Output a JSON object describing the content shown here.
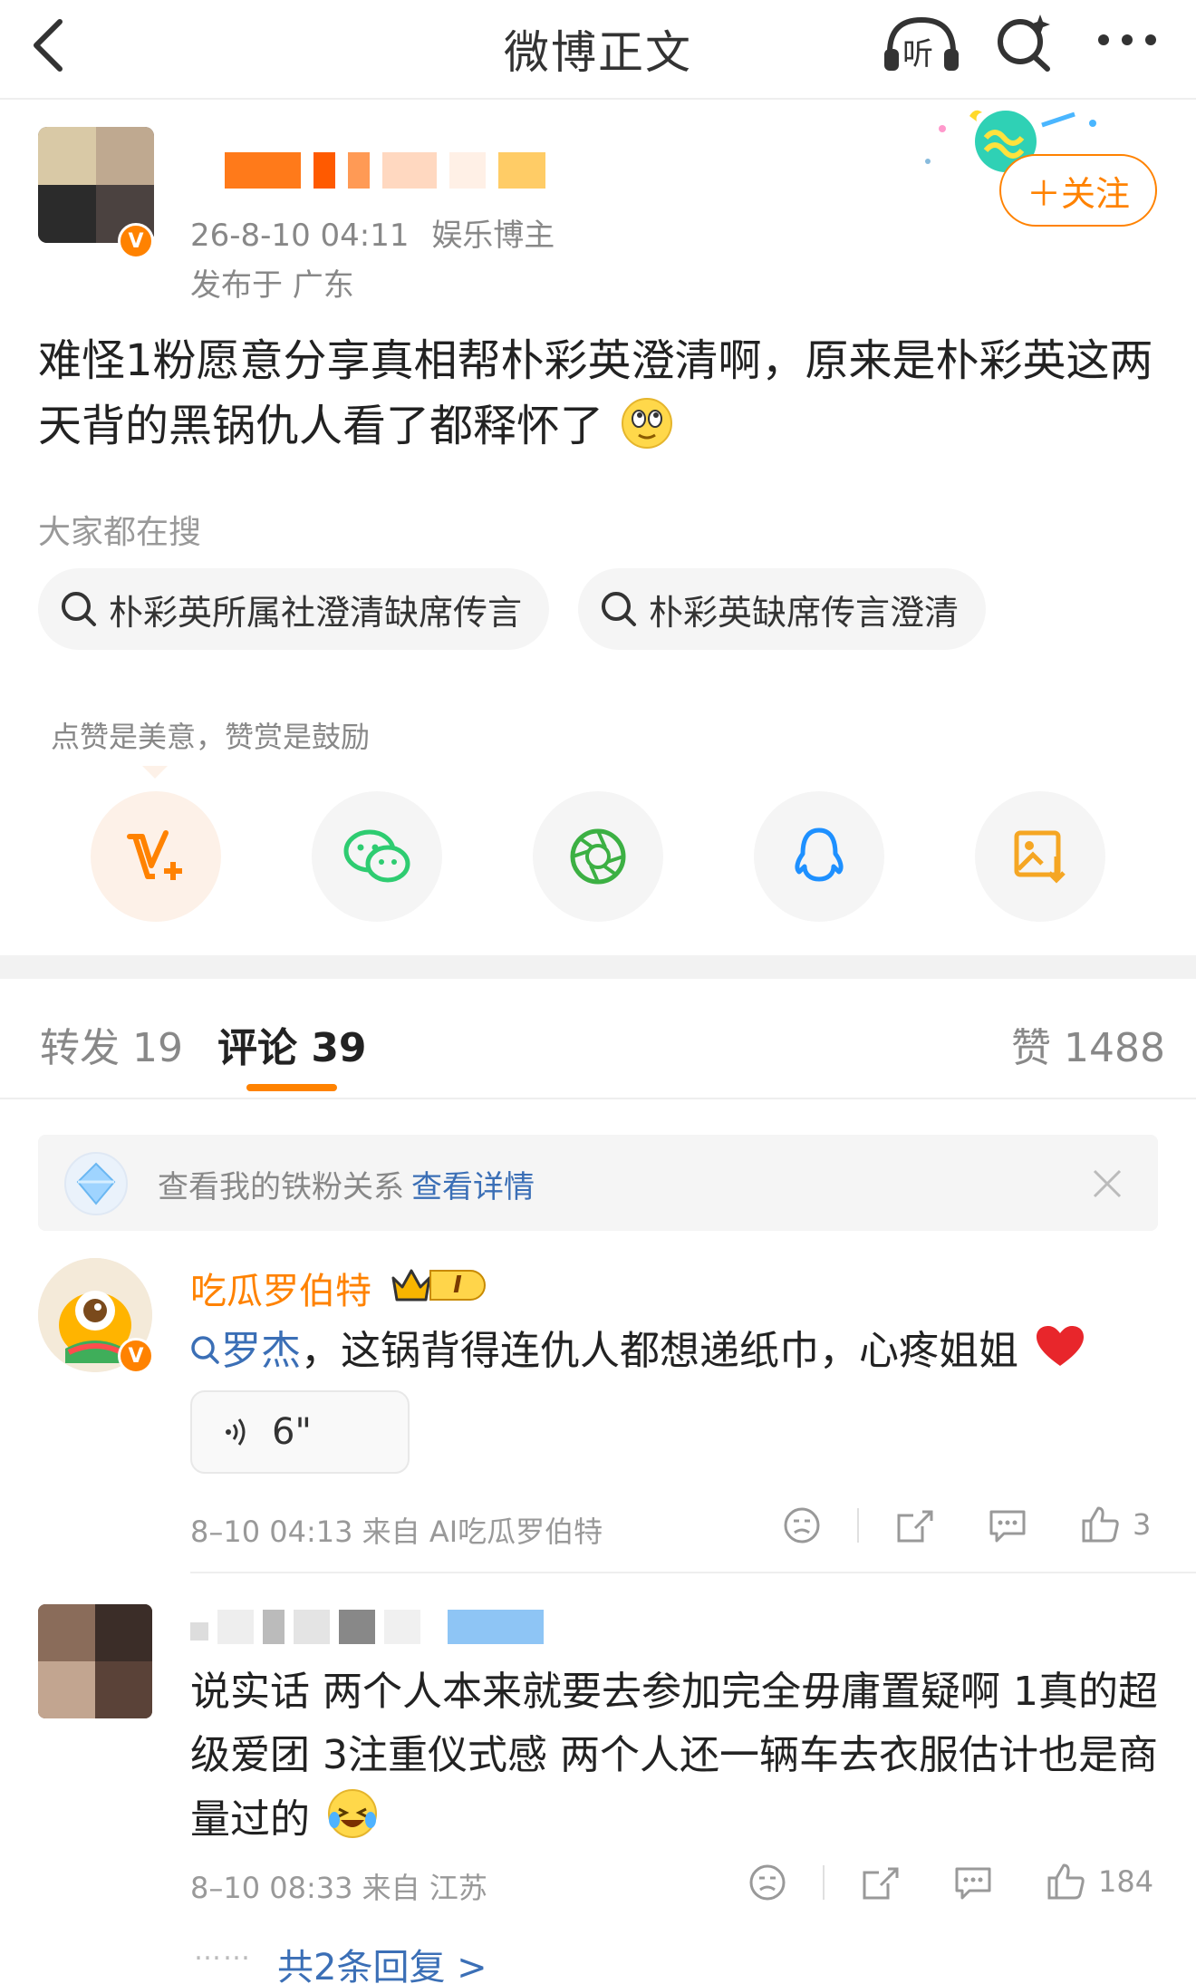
{
  "nav": {
    "title": "微博正文",
    "listen_label": "听"
  },
  "post": {
    "timestamp": "26-8-10 04:11",
    "author_role": "娱乐博主",
    "location": "发布于 广东",
    "follow_label": "＋关注",
    "text": "难怪1粉愿意分享真相帮朴彩英澄清啊，原来是朴彩英这两天背的黑锅仇人看了都释怀了"
  },
  "search": {
    "title": "大家都在搜",
    "chips": [
      "朴彩英所属社澄清缺席传言",
      "朴彩英缺席传言澄清"
    ]
  },
  "share": {
    "tip": "点赞是美意，赞赏是鼓励",
    "items": [
      "reward",
      "wechat",
      "moments",
      "qq",
      "save-image"
    ]
  },
  "tabs": {
    "repost": "转发 19",
    "comment": "评论 39",
    "like": "赞 1488"
  },
  "fan_banner": {
    "text": "查看我的铁粉关系",
    "link": "查看详情"
  },
  "comments": [
    {
      "user": "吃瓜罗伯特",
      "badge": "I",
      "mention": "罗杰",
      "text": "，这锅背得连仇人都想递纸巾，心疼姐姐",
      "voice": "6\"",
      "meta": "8–10 04:13  来自 AI吃瓜罗伯特",
      "likes": "3"
    },
    {
      "text": "说实话 两个人本来就要去参加完全毋庸置疑啊 1真的超级爱团 3注重仪式感 两个人还一辆车去衣服估计也是商量过的",
      "meta": "8–10 08:33  来自 江苏",
      "likes": "184",
      "replies": "共2条回复 >"
    }
  ],
  "colors": {
    "accent": "#ff8200",
    "link": "#3b6fb6"
  }
}
